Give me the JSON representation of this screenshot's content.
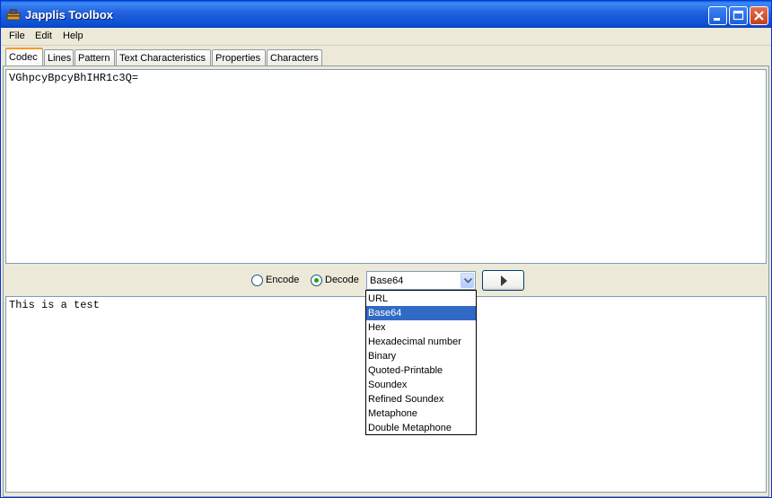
{
  "window": {
    "title": "Japplis Toolbox"
  },
  "menu": [
    "File",
    "Edit",
    "Help"
  ],
  "tabs": [
    "Codec",
    "Lines",
    "Pattern",
    "Text Characteristics",
    "Properties",
    "Characters"
  ],
  "codec": {
    "input_text": "VGhpcyBpcyBhIHR1c3Q=",
    "output_text": "This is a test",
    "encode_label": "Encode",
    "decode_label": "Decode",
    "selected_mode": "Decode",
    "selected_codec": "Base64",
    "codec_options": [
      "URL",
      "Base64",
      "Hex",
      "Hexadecimal number",
      "Binary",
      "Quoted-Printable",
      "Soundex",
      "Refined Soundex",
      "Metaphone",
      "Double Metaphone"
    ]
  },
  "colors": {
    "title_bar": "#2563e0",
    "selection": "#316ac5",
    "active_tab_accent": "#ff9a1a"
  }
}
